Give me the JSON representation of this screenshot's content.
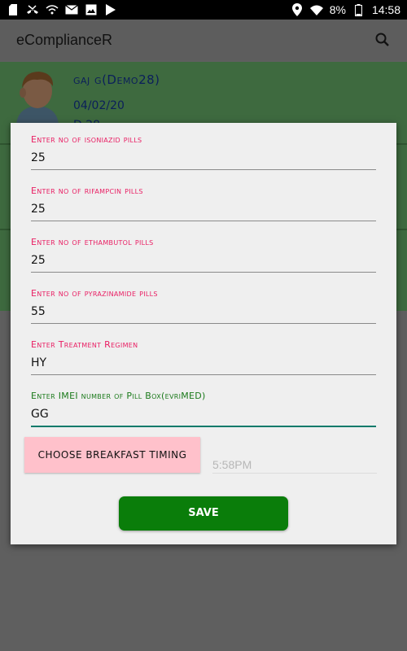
{
  "status_bar": {
    "battery": "8%",
    "time": "14:58",
    "icons": [
      "sim-icon",
      "missed-call-icon",
      "wifi-small-icon",
      "email-icon",
      "image-icon",
      "play-store-icon",
      "location-icon",
      "wifi-icon",
      "battery-icon"
    ]
  },
  "app_bar": {
    "title": "eComplianceR",
    "search_icon": "search-icon"
  },
  "background_list": {
    "patient_name": "gaj g(Demo28)",
    "date": "04/02/20",
    "partial_text": "D     28"
  },
  "dialog": {
    "fields": [
      {
        "label": "Enter no of isoniazid pills",
        "value": "25"
      },
      {
        "label": "Enter no of rifampcin pills",
        "value": "25"
      },
      {
        "label": "Enter no of ethambutol pills",
        "value": "25"
      },
      {
        "label": "Enter no of pyrazinamide pills",
        "value": "55"
      },
      {
        "label": "Enter Treatment Regimen",
        "value": "HY"
      },
      {
        "label": "Enter IMEI number of Pill Box(evriMED)",
        "value": "GG"
      }
    ],
    "breakfast_button": "CHOOSE BREAKFAST TIMING",
    "breakfast_time": "5:58PM",
    "save_button": "SAVE"
  },
  "colors": {
    "accent_pink": "#e91e63",
    "active_green": "#1b7a1b",
    "save_green": "#0a7d0a",
    "breakfast_pink": "#ffc1cb"
  }
}
